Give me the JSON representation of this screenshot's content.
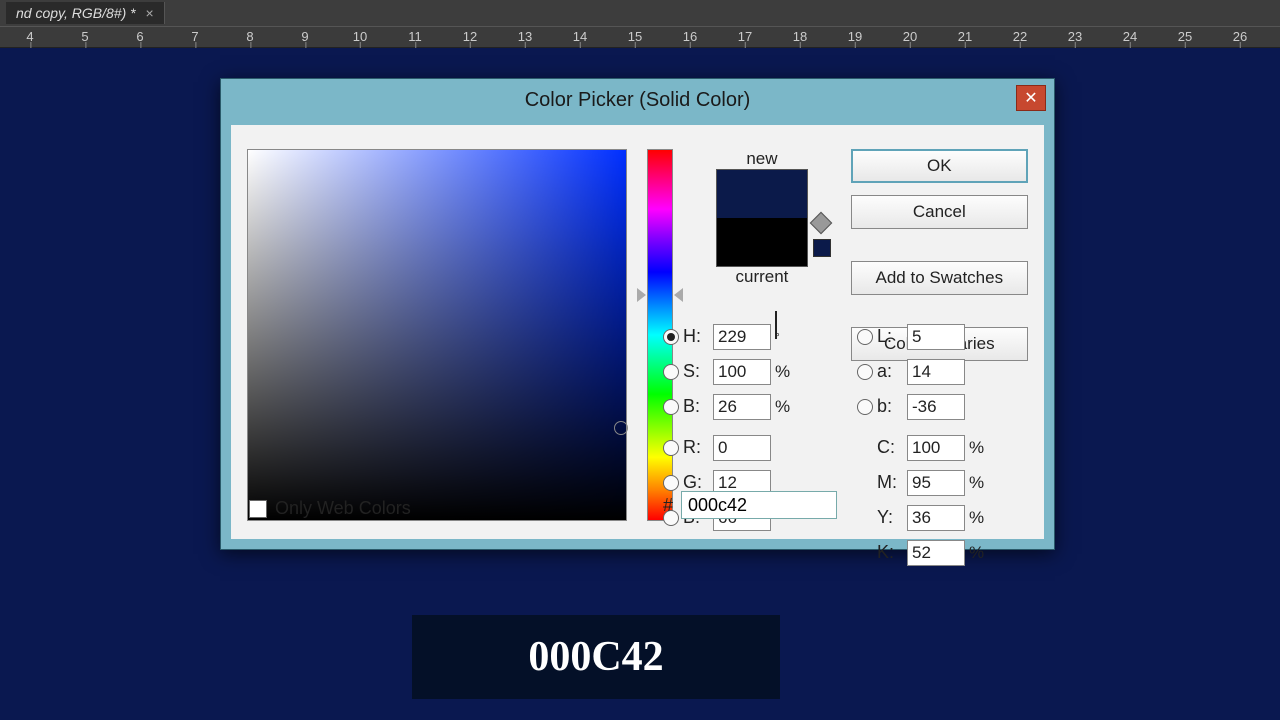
{
  "app": {
    "tab_title": "nd copy, RGB/8#) *"
  },
  "ruler": {
    "ticks": [
      "4",
      "5",
      "6",
      "7",
      "8",
      "9",
      "10",
      "11",
      "12",
      "13",
      "14",
      "15",
      "16",
      "17",
      "18",
      "19",
      "20",
      "21",
      "22",
      "23",
      "24",
      "25",
      "26"
    ]
  },
  "dialog": {
    "title": "Color Picker (Solid Color)",
    "close": "✕",
    "new_label": "new",
    "current_label": "current",
    "buttons": {
      "ok": "OK",
      "cancel": "Cancel",
      "swatches": "Add to Swatches",
      "libraries": "Color Libraries"
    },
    "hsb": {
      "h_label": "H:",
      "s_label": "S:",
      "b_label": "B:",
      "h": "229",
      "s": "100",
      "b": "26",
      "deg": "°",
      "pct": "%"
    },
    "rgb": {
      "r_label": "R:",
      "g_label": "G:",
      "b_label": "B:",
      "r": "0",
      "g": "12",
      "b": "66"
    },
    "lab": {
      "l_label": "L:",
      "a_label": "a:",
      "b_label": "b:",
      "l": "5",
      "a": "14",
      "b": "-36"
    },
    "cmyk": {
      "c_label": "C:",
      "m_label": "M:",
      "y_label": "Y:",
      "k_label": "K:",
      "c": "100",
      "m": "95",
      "y": "36",
      "k": "52",
      "pct": "%"
    },
    "hex_label": "#",
    "hex": "000c42",
    "web_label": "Only Web Colors",
    "colors": {
      "new": "#0b1a4a",
      "current": "#000000",
      "mini": "#0b1a4a",
      "canvas": "#0a1850"
    }
  },
  "banner": {
    "hex_upper": "000C42"
  }
}
